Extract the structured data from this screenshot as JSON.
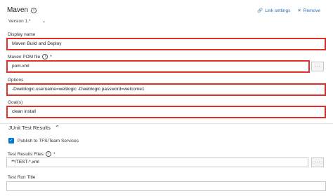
{
  "header": {
    "title": "Maven",
    "version_label": "Version",
    "version_value": "1.*",
    "link_settings": "Link settings",
    "remove": "Remove"
  },
  "fields": {
    "display_name": {
      "label": "Display name",
      "value": "Maven Build and Deploy"
    },
    "pom_file": {
      "label": "Maven POM file",
      "required": "*",
      "value": "pom.xml"
    },
    "options": {
      "label": "Options",
      "value": "-Dweblogic.username=weblogic -Dweblogic.password=welcome1"
    },
    "goals": {
      "label": "Goal(s)",
      "value": "clean install"
    }
  },
  "junit": {
    "section_title": "JUnit Test Results",
    "publish_label": "Publish to TFS/Team Services",
    "results_files_label": "Test Results Files",
    "results_files_required": "*",
    "results_files_value": "**/TEST-*.xml",
    "run_title_label": "Test Run Title"
  },
  "icons": {
    "info": "info-icon",
    "chevron": "chevron-down-icon",
    "link": "link-icon",
    "remove": "close-icon",
    "ellipsis": "ellipsis-icon",
    "collapse": "chevron-up-icon",
    "checkbox": "checkbox-checked-icon"
  },
  "colors": {
    "accent": "#2b6cb0",
    "highlight": "#e0312f",
    "checkbox": "#0078d4"
  }
}
